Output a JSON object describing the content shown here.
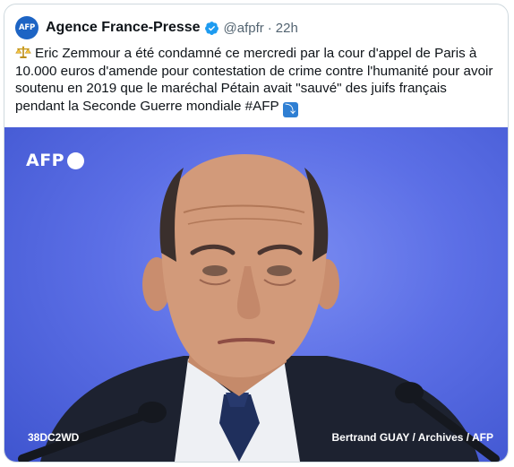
{
  "account": {
    "avatar_text": "AFP",
    "name": "Agence France-Presse",
    "handle": "@afpfr",
    "separator": "·",
    "time": "22h"
  },
  "tweet": {
    "text": "Eric Zemmour a été condamné ce mercredi par la cour d'appel de Paris à 10.000 euros d'amende pour contestation de crime contre l'humanité pour avoir soutenu en 2019 que le maréchal Pétain avait \"sauvé\" des juifs français pendant la Seconde Guerre mondiale #AFP",
    "leading_icon": "balance-scale-icon",
    "trailing_icon": "right-arrow-curving-down-icon",
    "trailing_glyph": "⤵"
  },
  "photo": {
    "logo_text": "AFP",
    "id_text": "38DC2WD",
    "credit_text": "Bertrand GUAY / Archives / AFP"
  },
  "colors": {
    "verified_blue": "#1d9bf0",
    "background_blue": "#5c6fe6",
    "text": "#0f1419",
    "muted": "#536471"
  }
}
